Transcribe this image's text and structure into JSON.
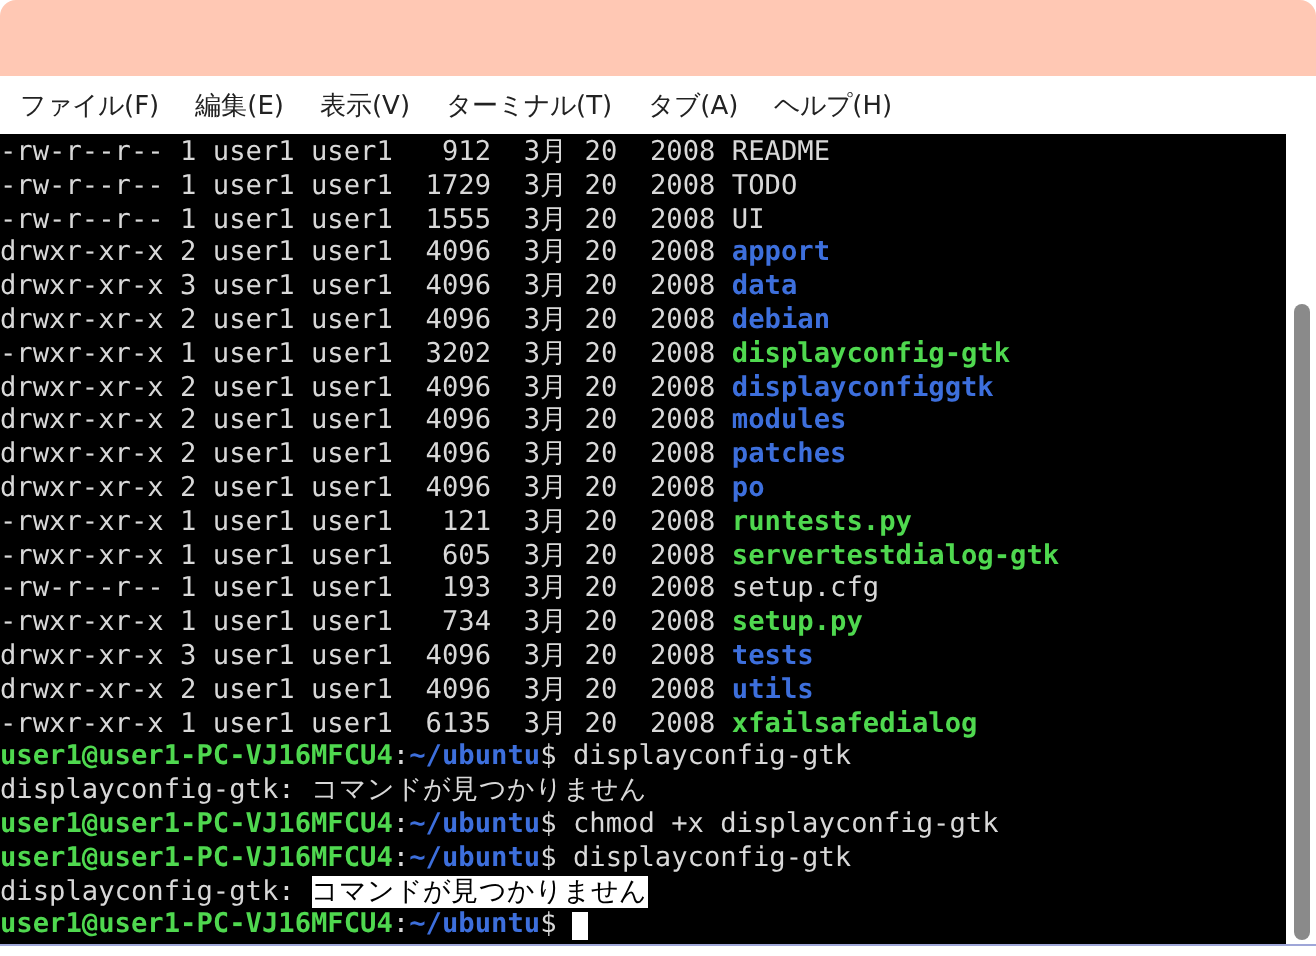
{
  "menu": [
    "ファイル(F)",
    "編集(E)",
    "表示(V)",
    "ターミナル(T)",
    "タブ(A)",
    "ヘルプ(H)"
  ],
  "lines": [
    {
      "kind": "entry",
      "info": "-rw-r--r-- 1 user1 user1   912  3月 20  2008",
      "name": "README",
      "color": "#d8d8d8",
      "bold": false
    },
    {
      "kind": "entry",
      "info": "-rw-r--r-- 1 user1 user1  1729  3月 20  2008",
      "name": "TODO",
      "color": "#d8d8d8",
      "bold": false
    },
    {
      "kind": "entry",
      "info": "-rw-r--r-- 1 user1 user1  1555  3月 20  2008",
      "name": "UI",
      "color": "#d8d8d8",
      "bold": false
    },
    {
      "kind": "entry",
      "info": "drwxr-xr-x 2 user1 user1  4096  3月 20  2008",
      "name": "apport",
      "color": "#3d6fdc",
      "bold": true
    },
    {
      "kind": "entry",
      "info": "drwxr-xr-x 3 user1 user1  4096  3月 20  2008",
      "name": "data",
      "color": "#3d6fdc",
      "bold": true
    },
    {
      "kind": "entry",
      "info": "drwxr-xr-x 2 user1 user1  4096  3月 20  2008",
      "name": "debian",
      "color": "#3d6fdc",
      "bold": true
    },
    {
      "kind": "entry",
      "info": "-rwxr-xr-x 1 user1 user1  3202  3月 20  2008",
      "name": "displayconfig-gtk",
      "color": "#4fd84f",
      "bold": true
    },
    {
      "kind": "entry",
      "info": "drwxr-xr-x 2 user1 user1  4096  3月 20  2008",
      "name": "displayconfiggtk",
      "color": "#3d6fdc",
      "bold": true
    },
    {
      "kind": "entry",
      "info": "drwxr-xr-x 2 user1 user1  4096  3月 20  2008",
      "name": "modules",
      "color": "#3d6fdc",
      "bold": true
    },
    {
      "kind": "entry",
      "info": "drwxr-xr-x 2 user1 user1  4096  3月 20  2008",
      "name": "patches",
      "color": "#3d6fdc",
      "bold": true
    },
    {
      "kind": "entry",
      "info": "drwxr-xr-x 2 user1 user1  4096  3月 20  2008",
      "name": "po",
      "color": "#3d6fdc",
      "bold": true
    },
    {
      "kind": "entry",
      "info": "-rwxr-xr-x 1 user1 user1   121  3月 20  2008",
      "name": "runtests.py",
      "color": "#4fd84f",
      "bold": true
    },
    {
      "kind": "entry",
      "info": "-rwxr-xr-x 1 user1 user1   605  3月 20  2008",
      "name": "servertestdialog-gtk",
      "color": "#4fd84f",
      "bold": true
    },
    {
      "kind": "entry",
      "info": "-rw-r--r-- 1 user1 user1   193  3月 20  2008",
      "name": "setup.cfg",
      "color": "#d8d8d8",
      "bold": false
    },
    {
      "kind": "entry",
      "info": "-rwxr-xr-x 1 user1 user1   734  3月 20  2008",
      "name": "setup.py",
      "color": "#4fd84f",
      "bold": true
    },
    {
      "kind": "entry",
      "info": "drwxr-xr-x 3 user1 user1  4096  3月 20  2008",
      "name": "tests",
      "color": "#3d6fdc",
      "bold": true
    },
    {
      "kind": "entry",
      "info": "drwxr-xr-x 2 user1 user1  4096  3月 20  2008",
      "name": "utils",
      "color": "#3d6fdc",
      "bold": true
    },
    {
      "kind": "entry",
      "info": "-rwxr-xr-x 1 user1 user1  6135  3月 20  2008",
      "name": "xfailsafedialog",
      "color": "#4fd84f",
      "bold": true
    },
    {
      "kind": "prompt",
      "user": "user1@user1-PC-VJ16MFCU4",
      "sep": ":",
      "path": "~/ubuntu",
      "sign": "$",
      "command": "displayconfig-gtk"
    },
    {
      "kind": "output",
      "prefix": "displayconfig-gtk:",
      "message": "コマンドが見つかりません",
      "selected": false
    },
    {
      "kind": "prompt",
      "user": "user1@user1-PC-VJ16MFCU4",
      "sep": ":",
      "path": "~/ubuntu",
      "sign": "$",
      "command": "chmod +x displayconfig-gtk"
    },
    {
      "kind": "prompt",
      "user": "user1@user1-PC-VJ16MFCU4",
      "sep": ":",
      "path": "~/ubuntu",
      "sign": "$",
      "command": "displayconfig-gtk"
    },
    {
      "kind": "output",
      "prefix": "displayconfig-gtk:",
      "message": "コマンドが見つかりません",
      "selected": true
    },
    {
      "kind": "prompt",
      "user": "user1@user1-PC-VJ16MFCU4",
      "sep": ":",
      "path": "~/ubuntu",
      "sign": "$",
      "cursor": true
    }
  ]
}
